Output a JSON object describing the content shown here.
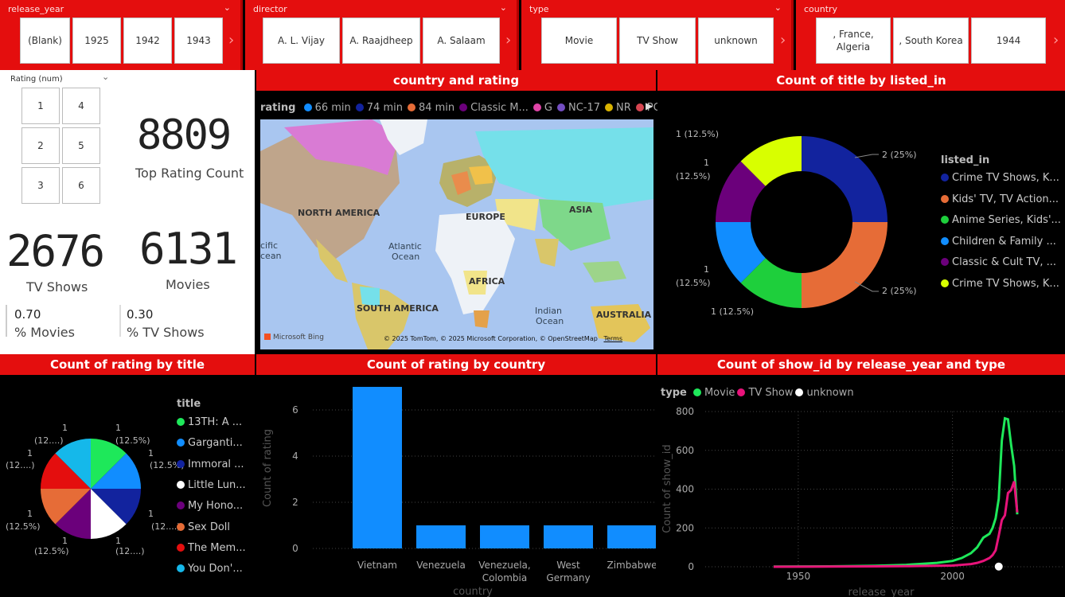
{
  "slicers": {
    "release_year": {
      "title": "release_year",
      "buttons": [
        "(Blank)",
        "1925",
        "1942",
        "1943"
      ]
    },
    "director": {
      "title": "director",
      "buttons": [
        "A. L. Vijay",
        "A. Raajdheep",
        "A. Salaam"
      ]
    },
    "type": {
      "title": "type",
      "buttons": [
        "Movie",
        "TV Show",
        "unknown"
      ]
    },
    "country": {
      "title": "country",
      "buttons": [
        ", France, Algeria",
        ", South Korea",
        "1944"
      ]
    }
  },
  "rating_slicer": {
    "title": "Rating (num)",
    "buttons": [
      "1",
      "4",
      "2",
      "5",
      "3",
      "6"
    ]
  },
  "cards": {
    "top_rating_value": "8809",
    "top_rating_label": "Top Rating Count",
    "tv_value": "2676",
    "tv_label": "TV Shows",
    "movies_value": "6131",
    "movies_label": "Movies",
    "pct_movies_value": "0.70",
    "pct_movies_label": "% Movies",
    "pct_tv_value": "0.30",
    "pct_tv_label": "% TV Shows"
  },
  "map": {
    "title": "country and rating",
    "legend_title": "rating",
    "legend": [
      {
        "label": "66 min",
        "color": "#118dff"
      },
      {
        "label": "74 min",
        "color": "#12239e"
      },
      {
        "label": "84 min",
        "color": "#e66c37"
      },
      {
        "label": "Classic M...",
        "color": "#6b007b"
      },
      {
        "label": "G",
        "color": "#e044a7"
      },
      {
        "label": "NC-17",
        "color": "#744ec2"
      },
      {
        "label": "NR",
        "color": "#d9b300"
      },
      {
        "label": "PG",
        "color": "#d64550"
      }
    ],
    "labels": {
      "na": "NORTH AMERICA",
      "eu": "EUROPE",
      "asia": "ASIA",
      "atl1": "Atlantic",
      "atl2": "Ocean",
      "af": "AFRICA",
      "sa": "SOUTH AMERICA",
      "ind1": "Indian",
      "ind2": "Ocean",
      "aus": "AUSTRALIA",
      "pac1": "cific",
      "pac2": "cean"
    },
    "brand": "Microsoft Bing",
    "copyright": "© 2025 TomTom, © 2025 Microsoft Corporation, © OpenStreetMap",
    "terms": "Terms"
  },
  "donut": {
    "title": "Count of title by listed_in",
    "legend_title": "listed_in",
    "data_labels": [
      "2 (25%)",
      "2 (25%)",
      "1 (12.5%)",
      "1",
      "(12.5%)",
      "1",
      "(12.5%)",
      "1 (12.5%)"
    ],
    "chart_data": {
      "type": "pie",
      "categories": [
        "Crime TV Shows, K...",
        "Kids' TV, TV Action...",
        "Anime Series, Kids'...",
        "Children & Family ...",
        "Classic & Cult TV, ...",
        "Crime TV Shows, K..."
      ],
      "values": [
        2,
        2,
        1,
        1,
        1,
        1
      ],
      "colors": [
        "#12239e",
        "#e66c37",
        "#1ecf3c",
        "#118dff",
        "#6b007b",
        "#d8ff00"
      ],
      "title": "Count of title by listed_in"
    }
  },
  "pie": {
    "title": "Count of rating by title",
    "legend_title": "title",
    "data_labels": [
      "1",
      "(12.5%)",
      "1",
      "(12.5%)",
      "1",
      "(12....)",
      "1",
      "(12....)",
      "1",
      "(12.5%)",
      "1",
      "(12.5%)",
      "1",
      "(12....)",
      "1",
      "(12....)"
    ],
    "chart_data": {
      "type": "pie",
      "categories": [
        "13TH: A ...",
        "Garganti...",
        "Immoral ...",
        "Little Lun...",
        "My Hono...",
        "Sex Doll",
        "The Mem...",
        "You Don'..."
      ],
      "values": [
        1,
        1,
        1,
        1,
        1,
        1,
        1,
        1
      ],
      "colors": [
        "#1ee85a",
        "#118dff",
        "#12239e",
        "#ffffff",
        "#6b007b",
        "#e66c37",
        "#e40e0e",
        "#15b8ea"
      ],
      "title": "Count of rating by title"
    }
  },
  "bar": {
    "title": "Count of rating by country",
    "chart_data": {
      "type": "bar",
      "categories": [
        "Vietnam",
        "Venezuela",
        "Venezuela, Colombia",
        "West Germany",
        "Zimbabwe"
      ],
      "category_lines": [
        [
          "Vietnam"
        ],
        [
          "Venezuela"
        ],
        [
          "Venezuela,",
          "Colombia"
        ],
        [
          "West",
          "Germany"
        ],
        [
          "Zimbabwe"
        ]
      ],
      "values": [
        7,
        1,
        1,
        1,
        1
      ],
      "ylim": [
        0,
        7
      ],
      "yticks": [
        "0",
        "2",
        "4",
        "6"
      ],
      "xlabel": "country",
      "ylabel": "Count of rating",
      "color": "#118dff"
    }
  },
  "line": {
    "title": "Count of show_id by release_year and type",
    "legend_title": "type",
    "legend": [
      {
        "label": "Movie",
        "color": "#1ee85a"
      },
      {
        "label": "TV Show",
        "color": "#e8137a"
      },
      {
        "label": "unknown",
        "color": "#ffffff"
      }
    ],
    "chart_data": {
      "type": "line",
      "xlabel": "release_year",
      "ylabel": "Count of show_id",
      "xlim": [
        1925,
        2021
      ],
      "ylim": [
        0,
        800
      ],
      "xticks": [
        "1950",
        "2000"
      ],
      "yticks": [
        "0",
        "200",
        "400",
        "600",
        "800"
      ],
      "series": [
        {
          "name": "Movie",
          "x": [
            1942,
            1960,
            1975,
            1985,
            1990,
            1995,
            2000,
            2003,
            2006,
            2008,
            2010,
            2012,
            2013,
            2014,
            2015,
            2016,
            2017,
            2018,
            2019,
            2020,
            2021
          ],
          "values": [
            1,
            2,
            5,
            10,
            15,
            20,
            30,
            45,
            70,
            100,
            150,
            170,
            200,
            250,
            350,
            650,
            765,
            760,
            630,
            520,
            270
          ]
        },
        {
          "name": "TV Show",
          "x": [
            1942,
            1960,
            1975,
            1985,
            1990,
            1995,
            2000,
            2003,
            2006,
            2008,
            2010,
            2012,
            2013,
            2014,
            2015,
            2016,
            2017,
            2018,
            2019,
            2020,
            2021
          ],
          "values": [
            0,
            1,
            2,
            3,
            4,
            5,
            6,
            10,
            14,
            20,
            30,
            45,
            60,
            85,
            160,
            240,
            265,
            380,
            395,
            440,
            280
          ]
        },
        {
          "name": "unknown",
          "x": [
            2015
          ],
          "values": [
            1
          ]
        }
      ]
    }
  }
}
